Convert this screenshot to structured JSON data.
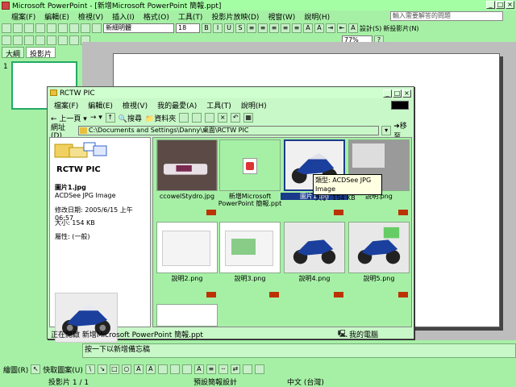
{
  "app": {
    "title": "Microsoft PowerPoint - [新增Microsoft PowerPoint 簡報.ppt]",
    "help_placeholder": "輸入需要解答的問題",
    "menu": [
      "檔案(F)",
      "編輯(E)",
      "檢視(V)",
      "插入(I)",
      "格式(O)",
      "工具(T)",
      "投影片放映(D)",
      "視窗(W)",
      "說明(H)"
    ]
  },
  "formatting": {
    "font": "新細明體",
    "size": "18",
    "zoom": "77%",
    "design_label": "設計(S)",
    "new_slide_label": "新投影片(N)"
  },
  "tabs": [
    "大綱",
    "投影片"
  ],
  "slide_number": "1",
  "notes_placeholder": "按一下以新增備忘稿",
  "draw_toolbar": {
    "draw_label": "繪圖(R)",
    "autoshapes_label": "快取圖案(U)"
  },
  "status": {
    "slide": "投影片 1 / 1",
    "design": "預設簡報設計",
    "language": "中文 (台灣)"
  },
  "explorer": {
    "title": "RCTW PIC",
    "menu": [
      "檔案(F)",
      "編輯(E)",
      "檢視(V)",
      "我的最愛(A)",
      "工具(T)",
      "說明(H)"
    ],
    "back_label": "上一頁",
    "search_label": "搜尋",
    "folders_label": "資料夾",
    "address_label": "網址(D)",
    "address": "C:\\Documents and Settings\\Danny\\桌面\\RCTW PIC",
    "go_label": "移至",
    "folder_heading": "RCTW PIC",
    "detail": {
      "name": "圖片1.jpg",
      "type": "ACDSee JPG Image",
      "modified": "修改日期: 2005/6/15 上午 06:57",
      "size": "大小: 154 KB",
      "attr": "屬性: (一般)"
    },
    "files": [
      {
        "name": "ccowelStydro.jpg"
      },
      {
        "name": "新增Microsoft PowerPoint 簡報.ppt"
      },
      {
        "name": "圖片1.jpg"
      },
      {
        "name": "說明.png"
      },
      {
        "name": "說明2.png"
      },
      {
        "name": "說明3.png"
      },
      {
        "name": "說明4.png"
      },
      {
        "name": "說明5.png"
      }
    ],
    "tooltip": {
      "type": "類型: ACDSee JPG Image",
      "size": "大小: 154 KB"
    },
    "status_left": "正在開啟 新增Microsoft PowerPoint 簡報.ppt",
    "status_right": "我的電腦"
  },
  "colors": {
    "background": "#a6f0a6",
    "selection": "#1a3a8a"
  }
}
